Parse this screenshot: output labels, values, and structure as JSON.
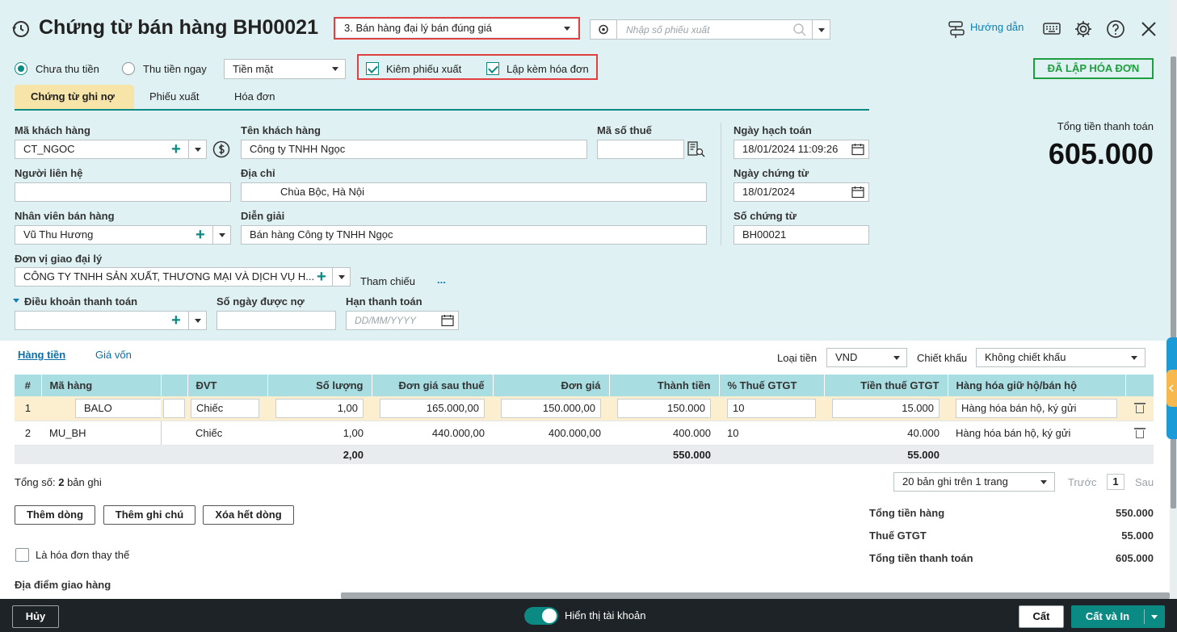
{
  "header": {
    "title": "Chứng từ bán hàng BH00021",
    "type_select": "3. Bán hàng đại lý bán đúng giá",
    "export_search_placeholder": "Nhập số phiếu xuất",
    "help_label": "Hướng dẫn"
  },
  "options": {
    "radio_unpaid": "Chưa thu tiền",
    "radio_paid": "Thu tiền ngay",
    "payment_method": "Tiền mặt",
    "check_export": "Kiêm phiếu xuất",
    "check_invoice": "Lập kèm hóa đơn",
    "status_badge": "ĐÃ LẬP HÓA ĐƠN"
  },
  "tabs": [
    "Chứng từ ghi nợ",
    "Phiếu xuất",
    "Hóa đơn"
  ],
  "form": {
    "customer_code_label": "Mã khách hàng",
    "customer_code": "CT_NGOC",
    "customer_name_label": "Tên khách hàng",
    "customer_name": "Công ty TNHH Ngọc",
    "tax_code_label": "Mã số thuế",
    "tax_code": "",
    "contact_label": "Người liên hệ",
    "contact": "",
    "address_label": "Địa chỉ",
    "address": "Chùa Bộc, Hà Nội",
    "salesperson_label": "Nhân viên bán hàng",
    "salesperson": "Vũ Thu Hương",
    "description_label": "Diễn giải",
    "description": "Bán hàng Công ty TNHH Ngọc",
    "agent_label": "Đơn vị giao đại lý",
    "agent": "CÔNG TY TNHH SẢN XUẤT, THƯƠNG MẠI VÀ DỊCH VỤ H...",
    "reference_label": "Tham chiếu",
    "reference_more": "...",
    "payment_terms_label": "Điều khoản thanh toán",
    "payment_terms": "",
    "credit_days_label": "Số ngày được nợ",
    "credit_days": "",
    "due_date_label": "Hạn thanh toán",
    "due_date_placeholder": "DD/MM/YYYY",
    "posting_date_label": "Ngày hạch toán",
    "posting_date": "18/01/2024 11:09:26",
    "voucher_date_label": "Ngày chứng từ",
    "voucher_date": "18/01/2024",
    "voucher_no_label": "Số chứng từ",
    "voucher_no": "BH00021",
    "total_label": "Tổng tiền thanh toán",
    "total": "605.000"
  },
  "detail_tabs": [
    "Hàng tiền",
    "Giá vốn"
  ],
  "currency_label": "Loại tiền",
  "currency": "VND",
  "discount_label": "Chiết khấu",
  "discount": "Không chiết khấu",
  "table": {
    "headers": [
      "#",
      "Mã hàng",
      "",
      "ĐVT",
      "Số lượng",
      "Đơn giá sau thuế",
      "Đơn giá",
      "Thành tiền",
      "% Thuế GTGT",
      "Tiền thuế GTGT",
      "Hàng hóa giữ hộ/bán hộ",
      ""
    ],
    "rows": [
      [
        "1",
        "BALO",
        "",
        "Chiếc",
        "1,00",
        "165.000,00",
        "150.000,00",
        "150.000",
        "10",
        "15.000",
        "Hàng hóa bán hộ, ký gửi"
      ],
      [
        "2",
        "MU_BH",
        "",
        "Chiếc",
        "1,00",
        "440.000,00",
        "400.000,00",
        "400.000",
        "10",
        "40.000",
        "Hàng hóa bán hộ, ký gửi"
      ]
    ],
    "sum_qty": "2,00",
    "sum_amount": "550.000",
    "sum_tax": "55.000"
  },
  "records": {
    "label": "Tổng số:",
    "count": "2",
    "suffix": "bản ghi",
    "page_size": "20 bản ghi trên 1 trang",
    "prev": "Trước",
    "page": "1",
    "next": "Sau"
  },
  "actions": {
    "add_row": "Thêm dòng",
    "add_note": "Thêm ghi chú",
    "delete_all": "Xóa hết dòng"
  },
  "replacement_label": "Là hóa đơn thay thế",
  "delivery_label": "Địa điểm giao hàng",
  "summary": {
    "goods_label": "Tổng tiền hàng",
    "goods": "550.000",
    "vat_label": "Thuế GTGT",
    "vat": "55.000",
    "total_label": "Tổng tiền thanh toán",
    "total": "605.000"
  },
  "footer": {
    "cancel": "Hủy",
    "toggle_label": "Hiển thị tài khoản",
    "save": "Cất",
    "save_print": "Cất và In"
  },
  "colors": {
    "accent": "#0b8a83",
    "highlight": "#e0403f",
    "header_bg": "#dff1f3",
    "table_header": "#a8dde2",
    "footer_bg": "#1d2327"
  }
}
